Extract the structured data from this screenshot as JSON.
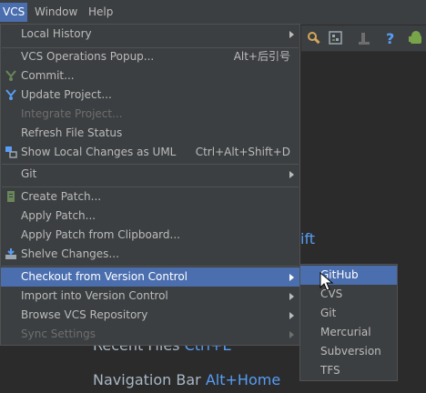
{
  "menubar": {
    "vcs": "VCS",
    "window": "Window",
    "help": "Help"
  },
  "vcs_menu": {
    "local_history": "Local History",
    "vcs_operations_popup": "VCS Operations Popup...",
    "vcs_operations_popup_shortcut": "Alt+后引号",
    "commit": "Commit...",
    "update_project": "Update Project...",
    "integrate_project": "Integrate Project...",
    "refresh_file_status": "Refresh File Status",
    "show_local_changes_as_uml": "Show Local Changes as UML",
    "show_local_changes_as_uml_shortcut": "Ctrl+Alt+Shift+D",
    "git": "Git",
    "create_patch": "Create Patch...",
    "apply_patch": "Apply Patch...",
    "apply_patch_from_clipboard": "Apply Patch from Clipboard...",
    "shelve_changes": "Shelve Changes...",
    "checkout_from_vcs": "Checkout from Version Control",
    "import_into_vcs": "Import into Version Control",
    "browse_vcs_repository": "Browse VCS Repository",
    "sync_settings": "Sync Settings"
  },
  "checkout_submenu": {
    "github": "GitHub",
    "cvs": "CVS",
    "git": "Git",
    "mercurial": "Mercurial",
    "subversion": "Subversion",
    "tfs": "TFS"
  },
  "editor": {
    "hint_fragment_shortcut": "ift",
    "recent_files_label": "Recent Files",
    "recent_files_shortcut": "Ctrl+E",
    "navigation_bar_label": "Navigation Bar",
    "navigation_bar_shortcut": "Alt+Home"
  },
  "colors": {
    "menu_background": "#3c3f41",
    "selection": "#4b6eaf",
    "editor_background": "#2b2b2b",
    "shortcut_blue": "#589df6"
  },
  "icons": {
    "toolbar": [
      "settings-tool-icon",
      "project-structure-icon",
      "run-icon",
      "help-icon",
      "android-icon"
    ],
    "menu": [
      "commit-icon",
      "update-project-icon",
      "uml-diagram-icon",
      "create-patch-icon",
      "shelve-changes-icon"
    ]
  }
}
